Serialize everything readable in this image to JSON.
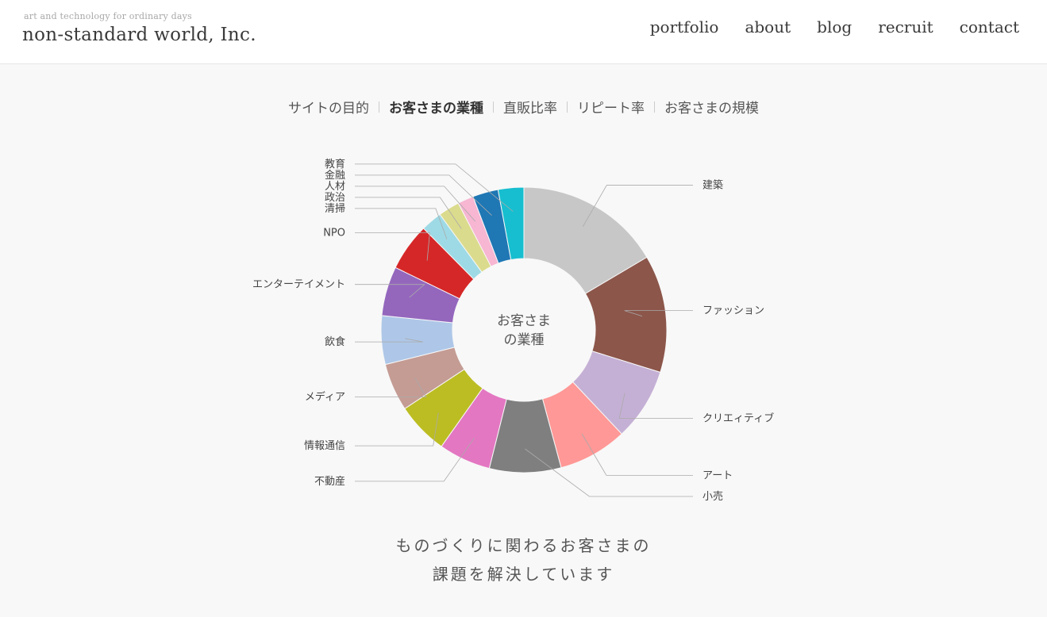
{
  "header": {
    "tagline": "art and technology for ordinary days",
    "logo": "non-standard world, Inc.",
    "nav": [
      "portfolio",
      "about",
      "blog",
      "recruit",
      "contact"
    ]
  },
  "tabs": {
    "items": [
      "サイトの目的",
      "お客さまの業種",
      "直販比率",
      "リピート率",
      "お客さまの規模"
    ],
    "active": 1
  },
  "chart_data": {
    "type": "pie",
    "center_label": [
      "お客さま",
      "の業種"
    ],
    "unit": "percent (estimated)",
    "slices": [
      {
        "label": "建築",
        "value": 16.5,
        "color": "#c7c7c7"
      },
      {
        "label": "ファッション",
        "value": 13.3,
        "color": "#8c564b"
      },
      {
        "label": "クリエィティブ",
        "value": 8.2,
        "color": "#c5b0d5"
      },
      {
        "label": "アート",
        "value": 7.8,
        "color": "#ff9896"
      },
      {
        "label": "小売",
        "value": 8.1,
        "color": "#7f7f7f"
      },
      {
        "label": "不動産",
        "value": 5.9,
        "color": "#e377c2"
      },
      {
        "label": "情報通信",
        "value": 5.9,
        "color": "#bcbd22"
      },
      {
        "label": "メディア",
        "value": 5.4,
        "color": "#c49c94"
      },
      {
        "label": "飲食",
        "value": 5.5,
        "color": "#aec7e8"
      },
      {
        "label": "エンターテイメント",
        "value": 5.6,
        "color": "#9467bd"
      },
      {
        "label": "NPO",
        "value": 5.4,
        "color": "#d62728"
      },
      {
        "label": "清掃",
        "value": 2.4,
        "color": "#9edae5"
      },
      {
        "label": "政治",
        "value": 2.4,
        "color": "#dbdb8d"
      },
      {
        "label": "人材",
        "value": 1.8,
        "color": "#f7b6d2"
      },
      {
        "label": "金融",
        "value": 2.9,
        "color": "#1f77b4"
      },
      {
        "label": "教育",
        "value": 2.9,
        "color": "#17becf"
      }
    ]
  },
  "caption": [
    "ものづくりに関わるお客さまの",
    "課題を解決しています"
  ]
}
